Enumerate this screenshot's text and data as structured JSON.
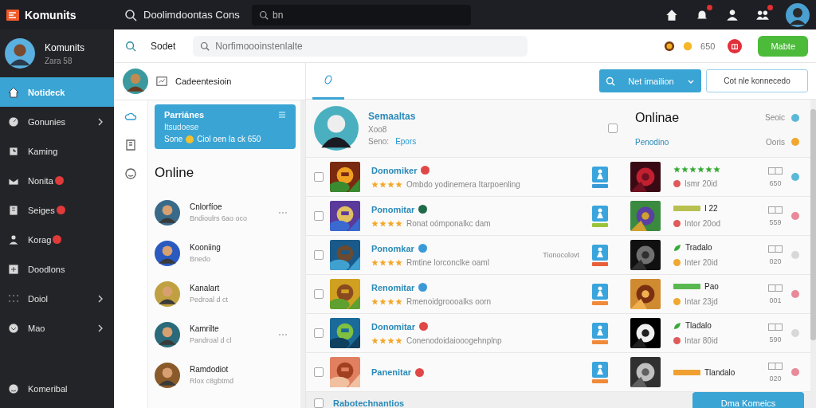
{
  "topbar": {
    "brand": "Komunits",
    "title": "Doolimdoontas Cons",
    "search": {
      "value": "bn"
    },
    "icons": [
      {
        "kind": "home",
        "badge": false
      },
      {
        "kind": "bell",
        "badge": true
      },
      {
        "kind": "person",
        "badge": false
      },
      {
        "kind": "group",
        "badge": true
      }
    ]
  },
  "sidebar": {
    "profile": {
      "name": "Komunits",
      "status": "Zara 58"
    },
    "items": [
      {
        "label": "Notideck",
        "kind": "home",
        "selected": true,
        "badge": false,
        "submenu": false
      },
      {
        "label": "Gonunies",
        "kind": "gauge",
        "selected": false,
        "badge": false,
        "submenu": true
      },
      {
        "label": "Kaming",
        "kind": "clock",
        "selected": false,
        "badge": false,
        "submenu": false
      },
      {
        "label": "Nonita",
        "kind": "mail",
        "selected": false,
        "badge": true,
        "submenu": false
      },
      {
        "label": "Seiges",
        "kind": "book",
        "selected": false,
        "badge": true,
        "submenu": false
      },
      {
        "label": "Korag",
        "kind": "person",
        "selected": false,
        "badge": true,
        "submenu": false
      },
      {
        "label": "Doodlons",
        "kind": "plus",
        "selected": false,
        "badge": false,
        "submenu": false
      },
      {
        "label": "Doiol",
        "kind": "grid",
        "selected": false,
        "badge": false,
        "submenu": true
      },
      {
        "label": "Mao",
        "kind": "chevron",
        "selected": false,
        "badge": false,
        "submenu": true
      }
    ],
    "footer": {
      "label": "Komeribal",
      "kind": "smile"
    }
  },
  "toolbar": {
    "label": "Sodet",
    "search": {
      "placeholder": "Norfimoooinstenlalte"
    },
    "coins": "650",
    "button": "Mabte"
  },
  "chats": {
    "header": "Cadeentesioin",
    "rail": [
      {
        "kind": "cloud",
        "selected": true
      },
      {
        "kind": "book",
        "selected": false
      },
      {
        "kind": "smile",
        "selected": false
      }
    ],
    "card": {
      "title": "Parriánes",
      "subtitle": "Itsudoese",
      "line_start": "Sone",
      "line_end": "Ciol oen Ia ck 650"
    },
    "heading": "Online",
    "contacts": [
      {
        "name": "Cnlorfíoe",
        "status": "Bndioulrs 6ao oco",
        "menu": true
      },
      {
        "name": "Kooniing",
        "status": "Bnedo",
        "menu": false
      },
      {
        "name": "Kanalart",
        "status": "Pedroal d ct",
        "menu": false
      },
      {
        "name": "Kamrilte",
        "status": "Pandroal d cl",
        "menu": true
      },
      {
        "name": "Ramdodiot",
        "status": "Rlox c8gbtmd",
        "menu": false
      }
    ]
  },
  "games": {
    "tab": {
      "selected": true
    },
    "primary_button": "Net imailion",
    "secondary_button": "Cot nle konnecedo",
    "profile": {
      "name": "Semaaltas",
      "handle": "Xoo8",
      "meta_label": "Seno:",
      "meta_link": "Epors",
      "checked": false,
      "status_title": "Onlinae",
      "status_label": "Seoic",
      "status_link": "Penodino",
      "status_count": "Ooris"
    },
    "rows": [
      {
        "checked": false,
        "title": "Donomiker",
        "badge": {
          "color": "#e04848"
        },
        "stars": 4,
        "description": "Ombdo yodinemera Itarpoenling",
        "tag": {
          "color": "#3a9ad8"
        },
        "right": {
          "kind": "stars",
          "stars": 6
        },
        "time": {
          "text": "Ismr 20id",
          "color": "#e05a5a"
        },
        "count": "650",
        "dot": {
          "color": "#5bb8d8"
        }
      },
      {
        "checked": false,
        "title": "Ponomitar",
        "badge": {
          "color": "#1f6a48"
        },
        "stars": 4,
        "description": "Ronat oómponalkc dam",
        "tag": {
          "color": "#9bc43c"
        },
        "right": {
          "kind": "tag",
          "color": "#b8c050",
          "label": "I 22"
        },
        "time": {
          "text": "Intor 20od",
          "color": "#e05a5a"
        },
        "count": "559",
        "dot": {
          "color": "#e88a9a"
        }
      },
      {
        "checked": false,
        "title": "Ponomkar",
        "badge": {
          "color": "#3a9ad8"
        },
        "stars": 4,
        "description": "Rmtine lorconclke oaml",
        "note": "Tionocolovt",
        "tag": {
          "color": "#e8603a"
        },
        "right": {
          "kind": "leaf",
          "label": "Tradalo"
        },
        "time": {
          "text": "Inter 20id",
          "color": "#f0a830"
        },
        "count": "020",
        "dot": {
          "color": "#d8d8d8"
        }
      },
      {
        "checked": false,
        "title": "Renomitar",
        "badge": {
          "color": "#3a9ad8"
        },
        "stars": 4,
        "description": "Rmenoidgroooalks oorn",
        "tag": {
          "color": "#f08a3a"
        },
        "right": {
          "kind": "tag",
          "color": "#5ab850",
          "label": "Pao"
        },
        "time": {
          "text": "Intar 23jd",
          "color": "#f0a830"
        },
        "count": "001",
        "dot": {
          "color": "#e88a9a"
        }
      },
      {
        "checked": false,
        "title": "Donomitar",
        "badge": {
          "color": "#e04848"
        },
        "stars": 4,
        "description": "Conenodoidaiooogehnplnp",
        "tag": {
          "color": "#f08a3a"
        },
        "right": {
          "kind": "leaf",
          "label": "Tladalo"
        },
        "time": {
          "text": "Intar 80id",
          "color": "#e05a5a"
        },
        "count": "590",
        "dot": {
          "color": "#d8d8d8"
        }
      },
      {
        "checked": false,
        "title": "Panenitar",
        "badge": {
          "color": "#e04848"
        },
        "tag": {
          "color": "#f08a3a"
        },
        "right": {
          "kind": "tag",
          "color": "#f0a030",
          "label": "Tlandalo"
        },
        "count": "020",
        "dot": {
          "color": "#e88a9a"
        }
      }
    ],
    "footer": {
      "checked": false,
      "partial_row": "Rabotechnantios",
      "button": "Dma Komeics"
    }
  }
}
